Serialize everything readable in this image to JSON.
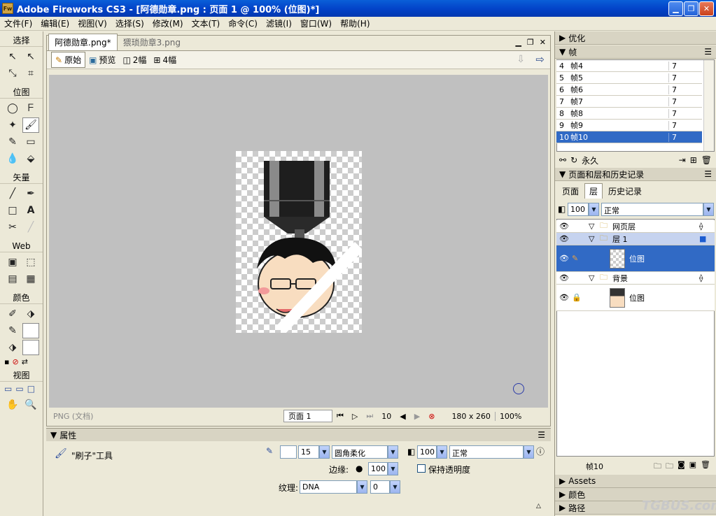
{
  "titlebar": {
    "title": "Adobe Fireworks CS3 - [阿德勋章.png : 页面 1 @ 100% (位图)*]",
    "icon": "Fw"
  },
  "menu": [
    "文件(F)",
    "编辑(E)",
    "视图(V)",
    "选择(S)",
    "修改(M)",
    "文本(T)",
    "命令(C)",
    "滤镜(I)",
    "窗口(W)",
    "帮助(H)"
  ],
  "tools": {
    "sections": [
      "选择",
      "位图",
      "矢量",
      "Web",
      "颜色",
      "视图"
    ],
    "icons": {
      "pointer": "↖",
      "subselect": "↖",
      "scale": "⤡",
      "crop": "⌗",
      "marquee": "◯",
      "lasso": "ᖴ",
      "magic_wand": "✦",
      "brush": "🖌",
      "pencil": "✎",
      "eraser": "▭",
      "blur": "💧",
      "rubber_stamp": "⬙",
      "line": "╱",
      "pen": "✒",
      "rectangle": "□",
      "text": "A",
      "knife": "✂",
      "freeform": "╱",
      "hotspot": "▣",
      "slice": "⬚",
      "hide_slice": "▤",
      "show_slice": "▦",
      "eyedropper": "✐",
      "paint_bucket": "⬗",
      "stroke_color": "✎",
      "fill_color": "⬗",
      "default_colors": "▪",
      "no_color": "⊘",
      "swap_colors": "⇄",
      "std_screen": "▭",
      "max_screen": "▭",
      "full_screen": "□",
      "hand": "✋",
      "zoom": "🔍"
    }
  },
  "document": {
    "tabs": [
      "阿德勋章.png*",
      "猥琐勋章3.png"
    ],
    "view_buttons": [
      "原始",
      "预览",
      "2幅",
      "4幅"
    ],
    "status": {
      "format": "PNG (文档)",
      "page": "页面 1",
      "frame": "10",
      "size": "180 x 260",
      "zoom": "100%"
    }
  },
  "properties": {
    "title": "属性",
    "tool_name": "\"刷子\"工具",
    "stroke_size": "15",
    "stroke_type": "圆角柔化",
    "edge_label": "边缘:",
    "edge_value": "100",
    "texture_label": "纹理:",
    "texture_value": "DNA",
    "texture_amount": "0",
    "opacity": "100",
    "blend": "正常",
    "preserve_transparency": "保持透明度"
  },
  "right": {
    "optimize": "优化",
    "frames_title": "帧",
    "frames": [
      {
        "num": "4",
        "name": "帧4",
        "delay": "7"
      },
      {
        "num": "5",
        "name": "帧5",
        "delay": "7"
      },
      {
        "num": "6",
        "name": "帧6",
        "delay": "7"
      },
      {
        "num": "7",
        "name": "帧7",
        "delay": "7"
      },
      {
        "num": "8",
        "name": "帧8",
        "delay": "7"
      },
      {
        "num": "9",
        "name": "帧9",
        "delay": "7"
      },
      {
        "num": "10",
        "name": "帧10",
        "delay": "7"
      }
    ],
    "loop": "永久",
    "pages_title": "页面和层和历史记录",
    "sub_tabs": [
      "页面",
      "层",
      "历史记录"
    ],
    "layer_opacity": "100",
    "layer_blend": "正常",
    "layers": [
      {
        "name": "网页层"
      },
      {
        "name": "层 1"
      },
      {
        "name": "位图"
      },
      {
        "name": "背景"
      },
      {
        "name": "位图"
      }
    ],
    "current_frame": "帧10",
    "assets": "Assets",
    "color": "颜色",
    "path": "路径",
    "watermark": "TGBUS.com"
  }
}
